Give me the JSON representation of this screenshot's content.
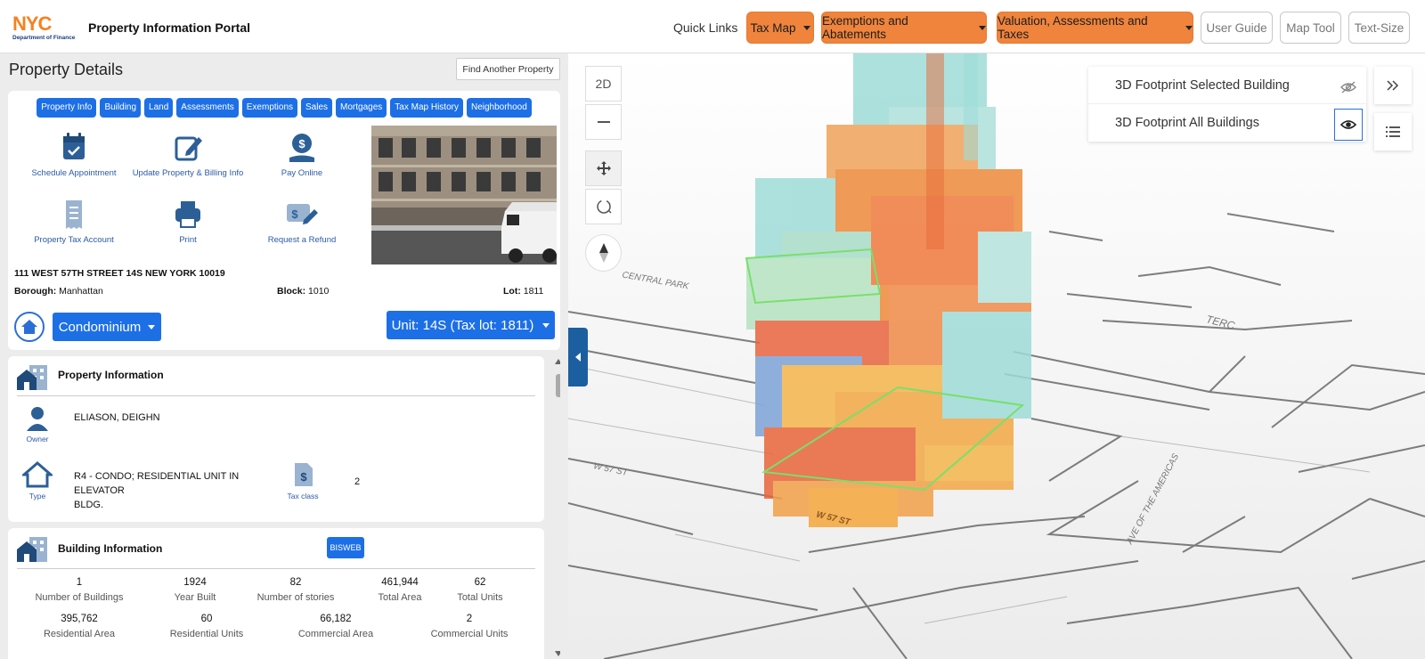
{
  "header": {
    "logo_nyc": "NYC",
    "logo_dept": "Department of Finance",
    "portal_title": "Property Information Portal",
    "quick_links": "Quick Links",
    "tax_map": "Tax Map",
    "exemptions": "Exemptions and Abatements",
    "valuation": "Valuation, Assessments and Taxes",
    "user_guide": "User Guide",
    "map_tool": "Map Tool",
    "text_size": "Text-Size"
  },
  "details": {
    "title": "Property Details",
    "find_another": "Find Another Property",
    "tabs": [
      "Property Info",
      "Building",
      "Land",
      "Assessments",
      "Exemptions",
      "Sales",
      "Mortgages",
      "Tax Map History",
      "Neighborhood"
    ],
    "actions": {
      "schedule": "Schedule Appointment",
      "update": "Update Property & Billing Info",
      "pay": "Pay Online",
      "tax_account": "Property Tax Account",
      "print": "Print",
      "refund": "Request a Refund"
    },
    "address": "111 WEST 57TH STREET 14S NEW YORK 10019",
    "borough_label": "Borough:",
    "borough": "Manhattan",
    "block_label": "Block:",
    "block": "1010",
    "lot_label": "Lot:",
    "lot": "1811",
    "condo": "Condominium",
    "unit": "Unit: 14S (Tax lot: 1811)"
  },
  "property_info": {
    "title": "Property Information",
    "owner_label": "Owner",
    "owner": "ELIASON, DEIGHN",
    "type_label": "Type",
    "type_line1": "R4 - CONDO; RESIDENTIAL UNIT IN ELEVATOR",
    "type_line2": "BLDG.",
    "tax_class_label": "Tax class",
    "tax_class": "2"
  },
  "building_info": {
    "title": "Building Information",
    "bisweb": "BISWEB",
    "stats": [
      {
        "value": "1",
        "label": "Number of Buildings"
      },
      {
        "value": "1924",
        "label": "Year Built"
      },
      {
        "value": "82",
        "label": "Number of stories"
      },
      {
        "value": "461,944",
        "label": "Total Area"
      },
      {
        "value": "62",
        "label": "Total Units"
      },
      {
        "value": "395,762",
        "label": "Residential Area"
      },
      {
        "value": "60",
        "label": "Residential Units"
      },
      {
        "value": "66,182",
        "label": "Commercial Area"
      },
      {
        "value": "2",
        "label": "Commercial Units"
      }
    ]
  },
  "map": {
    "btn_2d": "2D",
    "layer_selected": "3D Footprint Selected Building",
    "layer_all": "3D Footprint All Buildings",
    "labels": {
      "central_park": "CENTRAL PARK",
      "w57_a": "W 57 ST",
      "w57_b": "W 57 ST",
      "ave_americas": "AVE OF THE AMERICAS",
      "terc": "TERC"
    }
  },
  "colors": {
    "brand_orange": "#f0843c",
    "primary_blue": "#1d6fe6",
    "nav_blue": "#1b5fa0"
  }
}
